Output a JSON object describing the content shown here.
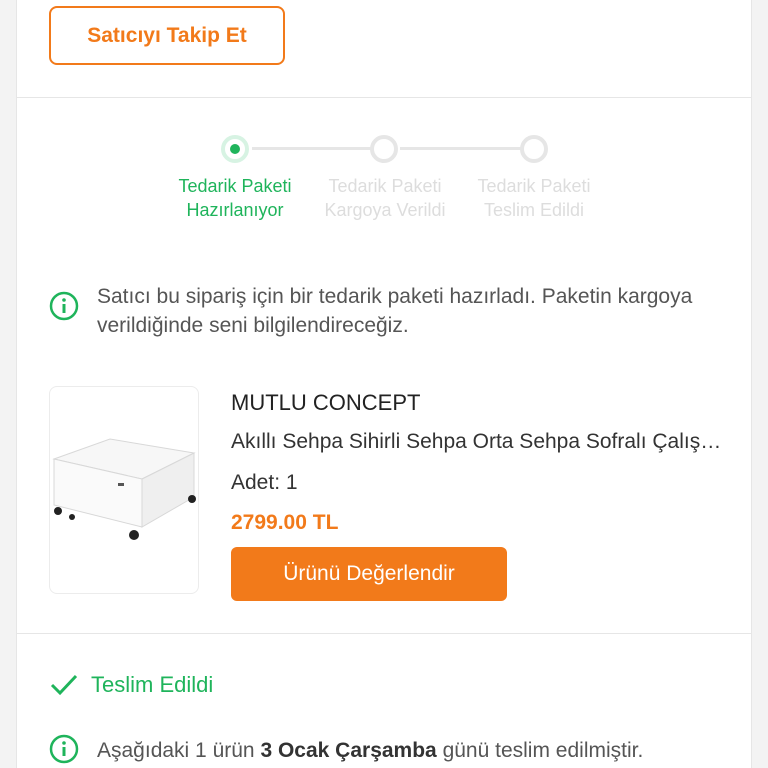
{
  "seller": {
    "follow_label": "Satıcıyı Takip Et"
  },
  "stepper": {
    "steps": [
      {
        "label": "Tedarik Paketi Hazırlanıyor",
        "status": "active"
      },
      {
        "label": "Tedarik Paketi Kargoya Verildi",
        "status": "pending"
      },
      {
        "label": "Tedarik Paketi Teslim Edildi",
        "status": "pending"
      }
    ]
  },
  "info": {
    "message": "Satıcı bu sipariş için bir tedarik paketi hazırladı. Paketin kargoya verildiğinde seni bilgilendireceğiz."
  },
  "product": {
    "brand": "MUTLU CONCEPT",
    "name": "Akıllı Sehpa Sihirli Sehpa Orta Sehpa Sofralı Çalışma Masası",
    "quantity": "Adet: 1",
    "price": "2799.00 TL",
    "rate_label": "Ürünü Değerlendir"
  },
  "delivery": {
    "status": "Teslim Edildi",
    "note_prefix": "Aşağıdaki 1 ürün",
    "note_date": "3 Ocak Çarşamba",
    "note_suffix": "günü teslim edilmiştir."
  },
  "colors": {
    "accent": "#f27a1a",
    "success": "#1fb45b",
    "inactive": "#e6e6e6"
  }
}
